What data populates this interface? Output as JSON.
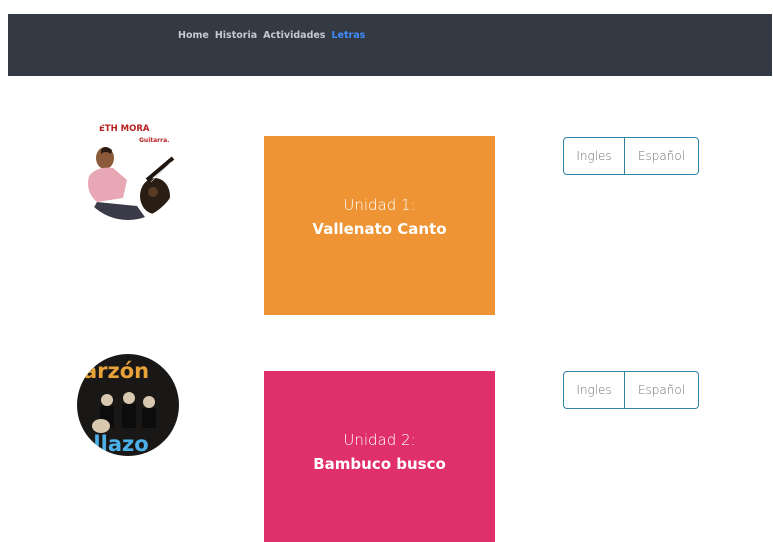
{
  "nav": {
    "items": [
      {
        "label": "Home"
      },
      {
        "label": "Historia"
      },
      {
        "label": "Actividades"
      },
      {
        "label": "Letras",
        "active": true
      }
    ]
  },
  "units": [
    {
      "label": "Unidad 1:",
      "title": "Vallenato Canto",
      "color": "#ee9435",
      "avatar_text": [
        "ETH MORA",
        "Guitarra."
      ],
      "buttons": {
        "english": "Ingles",
        "spanish": "Español"
      }
    },
    {
      "label": "Unidad 2:",
      "title": "Bambuco busco",
      "color": "#e0306c",
      "avatar_text": [
        "arzón",
        "ollazo"
      ],
      "buttons": {
        "english": "Ingles",
        "spanish": "Español"
      }
    }
  ],
  "colors": {
    "navbar": "#343a44",
    "nav_active": "#3e8bff",
    "button_border": "#2f84a5"
  }
}
